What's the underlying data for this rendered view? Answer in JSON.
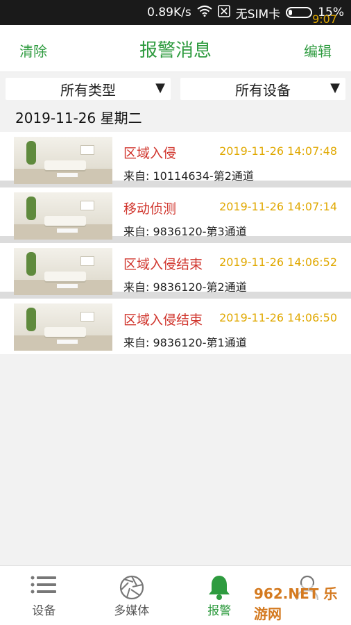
{
  "statusbar": {
    "time": "9:07",
    "speed": "0.89K/s",
    "sim": "无SIM卡",
    "battery": "15%",
    "battery_level": 0.15
  },
  "header": {
    "clear": "清除",
    "title": "报警消息",
    "edit": "编辑"
  },
  "filters": {
    "type": "所有类型",
    "device": "所有设备"
  },
  "date_header": "2019-11-26  星期二",
  "alarms": [
    {
      "type": "区域入侵",
      "time": "2019-11-26 14:07:48",
      "from": "来自: 10114634-第2通道"
    },
    {
      "type": "移动侦测",
      "time": "2019-11-26 14:07:14",
      "from": "来自: 9836120-第3通道"
    },
    {
      "type": "区域入侵结束",
      "time": "2019-11-26 14:06:52",
      "from": "来自: 9836120-第2通道"
    },
    {
      "type": "区域入侵结束",
      "time": "2019-11-26 14:06:50",
      "from": "来自: 9836120-第1通道"
    }
  ],
  "tabs": [
    {
      "label": "设备",
      "icon": "list-icon"
    },
    {
      "label": "多媒体",
      "icon": "camera-aperture-icon"
    },
    {
      "label": "报警",
      "icon": "bell-icon"
    },
    {
      "label": "",
      "icon": "user-icon"
    }
  ],
  "watermark": "962.NET 乐游网",
  "colors": {
    "accent": "#2e9b3f",
    "alarm_type": "#d0342c",
    "alarm_time": "#e0a800"
  }
}
